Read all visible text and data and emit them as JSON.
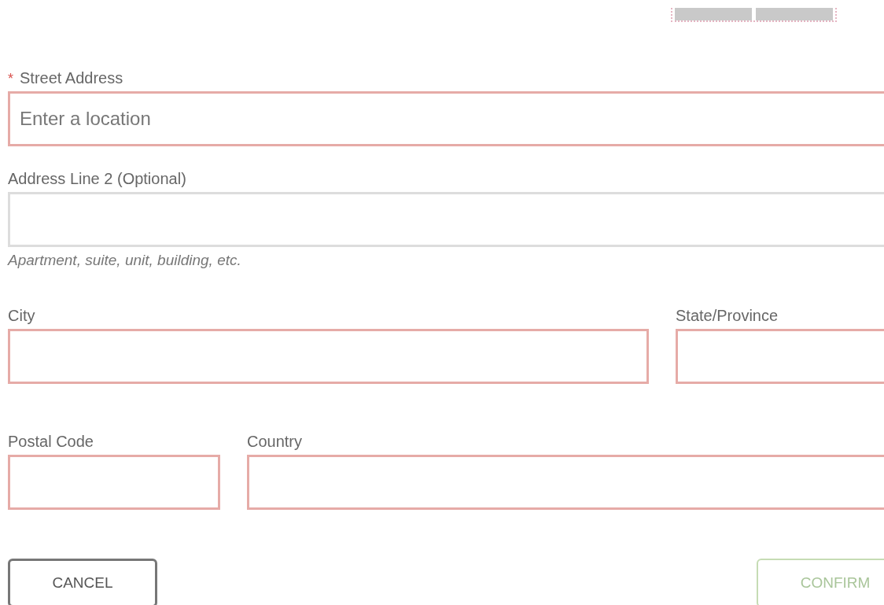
{
  "fields": [
    {
      "label": "Street Address",
      "required_mark": "*",
      "invalid": true,
      "placeholder": "Enter a location"
    },
    {
      "label": "Address Line 2 (Optional)",
      "invalid": false,
      "hint": "Apartment, suite, unit, building, etc."
    },
    {
      "label": "City",
      "invalid": true
    },
    {
      "label": "State/Province",
      "invalid": true
    },
    {
      "label": "Postal Code",
      "invalid": true
    },
    {
      "label": "Country",
      "invalid": true
    }
  ],
  "buttons": [
    {
      "label": "CANCEL",
      "kind": "cancel",
      "disabled": false
    },
    {
      "label": "CONFIRM",
      "kind": "confirm",
      "disabled": true
    }
  ]
}
